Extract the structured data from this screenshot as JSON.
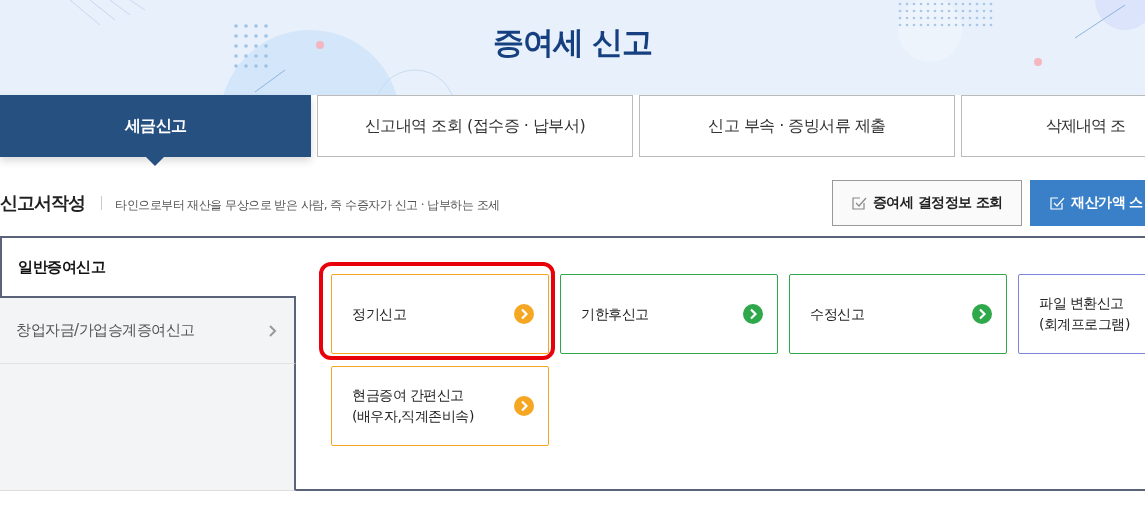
{
  "banner": {
    "title": "증여세 신고"
  },
  "tabs": [
    {
      "label": "세금신고",
      "selected": true
    },
    {
      "label": "신고내역 조회 (접수증 · 납부서)",
      "selected": false
    },
    {
      "label": "신고 부속 · 증빙서류 제출",
      "selected": false
    },
    {
      "label": "삭제내역 조",
      "selected": false
    }
  ],
  "section": {
    "title": "신고서작성",
    "description": "타인으로부터 재산을 무상으로 받은 사람, 즉 수증자가 신고 · 납부하는 조세",
    "buttons": [
      {
        "label": "증여세 결정정보 조회",
        "kind": "outline"
      },
      {
        "label": "재산가액 스",
        "kind": "primary"
      }
    ]
  },
  "sidebar": {
    "items": [
      {
        "label": "일반증여신고",
        "selected": true
      },
      {
        "label": "창업자금/가업승계증여신고",
        "selected": false
      }
    ]
  },
  "cards": [
    {
      "lines": [
        "정기신고"
      ],
      "color": "#f5a623",
      "highlighted": true
    },
    {
      "lines": [
        "기한후신고"
      ],
      "color": "#2ea84a",
      "highlighted": false
    },
    {
      "lines": [
        "수정신고"
      ],
      "color": "#2ea84a",
      "highlighted": false
    },
    {
      "lines": [
        "파일 변환신고",
        "(회계프로그램)"
      ],
      "color": "#7b86d8",
      "highlighted": false
    },
    {
      "lines": [
        "현금증여 간편신고",
        "(배우자,직계존비속)"
      ],
      "color": "#f5a623",
      "highlighted": false
    }
  ]
}
